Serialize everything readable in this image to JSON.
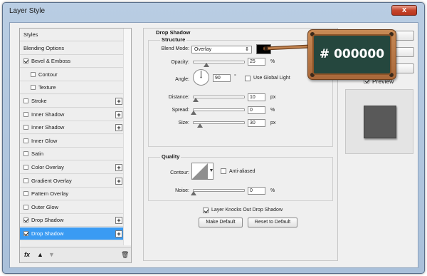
{
  "window": {
    "title": "Layer Style",
    "close_label": "x"
  },
  "style_list": {
    "items": [
      {
        "label": "Styles",
        "checkbox": false,
        "checked": false,
        "indent": false,
        "plus": false,
        "selected": false
      },
      {
        "label": "Blending Options",
        "checkbox": false,
        "checked": false,
        "indent": false,
        "plus": false,
        "selected": false
      },
      {
        "label": "Bevel & Emboss",
        "checkbox": true,
        "checked": true,
        "indent": false,
        "plus": false,
        "selected": false
      },
      {
        "label": "Contour",
        "checkbox": true,
        "checked": false,
        "indent": true,
        "plus": false,
        "selected": false
      },
      {
        "label": "Texture",
        "checkbox": true,
        "checked": false,
        "indent": true,
        "plus": false,
        "selected": false
      },
      {
        "label": "Stroke",
        "checkbox": true,
        "checked": false,
        "indent": false,
        "plus": true,
        "selected": false
      },
      {
        "label": "Inner Shadow",
        "checkbox": true,
        "checked": false,
        "indent": false,
        "plus": true,
        "selected": false
      },
      {
        "label": "Inner Shadow",
        "checkbox": true,
        "checked": false,
        "indent": false,
        "plus": true,
        "selected": false
      },
      {
        "label": "Inner Glow",
        "checkbox": true,
        "checked": false,
        "indent": false,
        "plus": false,
        "selected": false
      },
      {
        "label": "Satin",
        "checkbox": true,
        "checked": false,
        "indent": false,
        "plus": false,
        "selected": false
      },
      {
        "label": "Color Overlay",
        "checkbox": true,
        "checked": false,
        "indent": false,
        "plus": true,
        "selected": false
      },
      {
        "label": "Gradient Overlay",
        "checkbox": true,
        "checked": false,
        "indent": false,
        "plus": true,
        "selected": false
      },
      {
        "label": "Pattern Overlay",
        "checkbox": true,
        "checked": false,
        "indent": false,
        "plus": false,
        "selected": false
      },
      {
        "label": "Outer Glow",
        "checkbox": true,
        "checked": false,
        "indent": false,
        "plus": false,
        "selected": false
      },
      {
        "label": "Drop Shadow",
        "checkbox": true,
        "checked": true,
        "indent": false,
        "plus": true,
        "selected": false
      },
      {
        "label": "Drop Shadow",
        "checkbox": true,
        "checked": true,
        "indent": false,
        "plus": true,
        "selected": true
      }
    ],
    "footer": {
      "fx_label": "fx",
      "up_icon": "arrow-up-icon",
      "down_icon": "arrow-down-icon",
      "trash_icon": "trash-icon"
    }
  },
  "drop_shadow": {
    "section_title": "Drop Shadow",
    "structure_title": "Structure",
    "blend_mode_label": "Blend Mode:",
    "blend_mode_value": "Overlay",
    "shadow_color": "#000000",
    "opacity_label": "Opacity:",
    "opacity_value": "25",
    "opacity_unit": "%",
    "opacity_level": 0.25,
    "angle_label": "Angle:",
    "angle_value": "90",
    "angle_unit": "°",
    "use_global_light_label": "Use Global Light",
    "use_global_light_checked": false,
    "distance_label": "Distance:",
    "distance_value": "10",
    "distance_unit": "px",
    "distance_level": 0.04,
    "spread_label": "Spread:",
    "spread_value": "0",
    "spread_unit": "%",
    "spread_level": 0,
    "size_label": "Size:",
    "size_value": "30",
    "size_unit": "px",
    "size_level": 0.12,
    "quality_title": "Quality",
    "contour_label": "Contour:",
    "anti_aliased_label": "Anti-aliased",
    "anti_aliased_checked": false,
    "noise_label": "Noise:",
    "noise_value": "0",
    "noise_unit": "%",
    "noise_level": 0,
    "knockout_label": "Layer Knocks Out Drop Shadow",
    "knockout_checked": true,
    "make_default_label": "Make Default",
    "reset_default_label": "Reset to Default"
  },
  "right_column": {
    "preview_label": "Preview",
    "preview_checked": true,
    "preview_color": "#595959"
  },
  "callout": {
    "text": "# 000000",
    "color": "#000000"
  }
}
